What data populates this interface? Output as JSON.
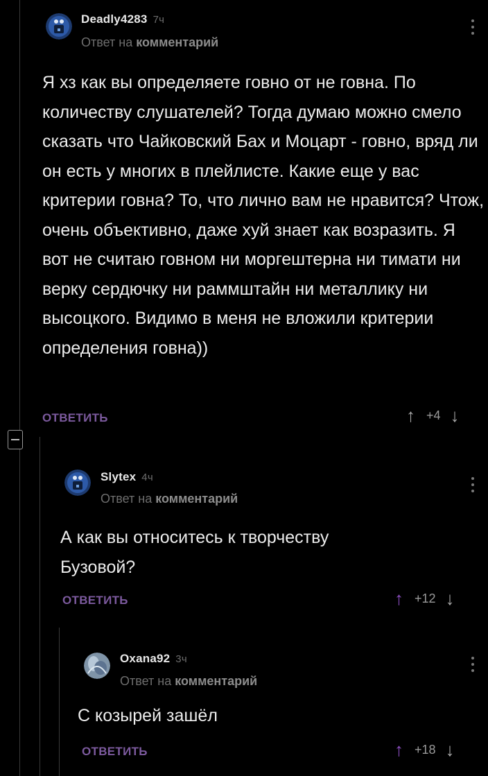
{
  "comments": [
    {
      "username": "Deadly4283",
      "time": "7ч",
      "reply_prefix": "Ответ на",
      "reply_target": "комментарий",
      "text": "Я хз как вы определяете говно от не говна. По количеству слушателей? Тогда думаю можно смело сказать что Чайковский Бах и Моцарт - говно, вряд ли он есть у многих в плейлисте. Какие еще у вас критерии говна? То, что лично вам не нравится? Чтож, очень объективно, даже хуй знает как возразить. Я вот не считаю говном ни моргештерна ни тимати ни верку сердючку ни раммштайн ни металлику ни высоцкого. Видимо в меня не вложили критерии определения говна))",
      "reply_label": "ОТВЕТИТЬ",
      "score": "+4",
      "upvoted": false
    },
    {
      "username": "Slytex",
      "time": "4ч",
      "reply_prefix": "Ответ на",
      "reply_target": "комментарий",
      "text": "А как вы относитесь к творчеству Бузовой?",
      "reply_label": "ОТВЕТИТЬ",
      "score": "+12",
      "upvoted": true
    },
    {
      "username": "Oxana92",
      "time": "3ч",
      "reply_prefix": "Ответ на",
      "reply_target": "комментарий",
      "text": "С козырей зашёл",
      "reply_label": "ОТВЕТИТЬ",
      "score": "+18",
      "upvoted": true
    }
  ],
  "icons": {
    "upvote": "↑",
    "downvote": "↓",
    "more": "kebab-icon",
    "collapse": "minus-icon"
  },
  "colors": {
    "background": "#000000",
    "reply_button": "#7c5a9e",
    "upvote_active": "#8e4fc4"
  }
}
